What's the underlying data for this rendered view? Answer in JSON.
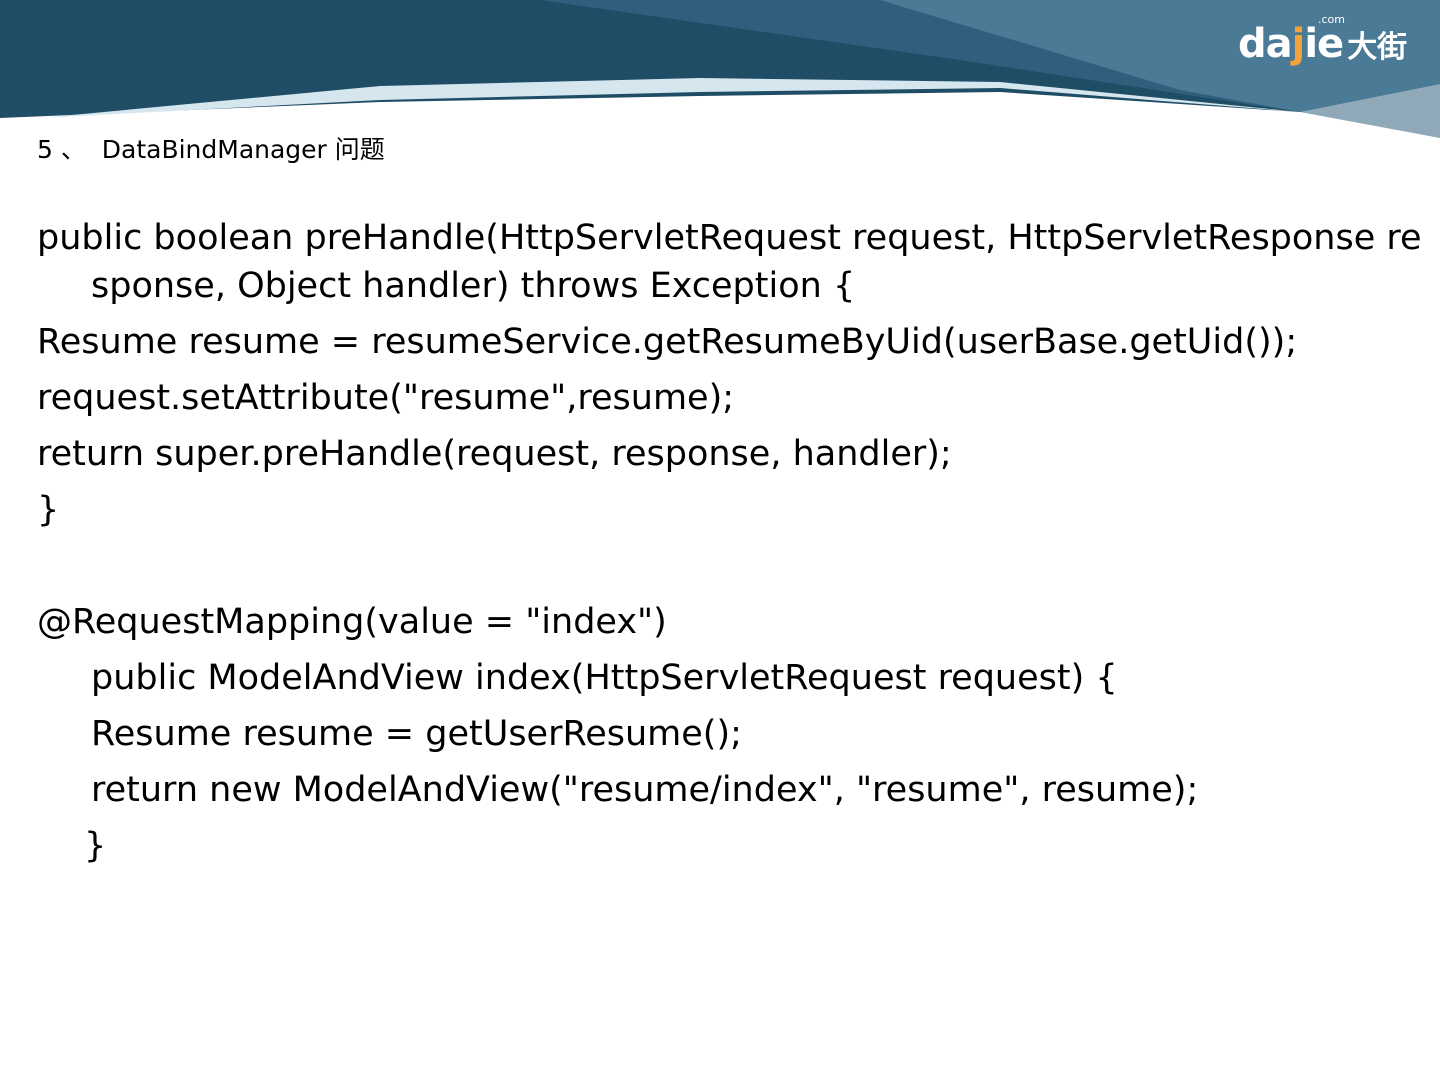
{
  "logo": {
    "latin_before": "da",
    "latin_j": "j",
    "latin_after": "ie",
    "chinese": "大街",
    "com": ".com"
  },
  "slide": {
    "section_title": "5 、  DataBindManager 问题",
    "code_lines": [
      "public boolean preHandle(HttpServletRequest request, HttpServletResponse re",
      "sponse, Object handler) throws Exception {",
      "Resume resume = resumeService.getResumeByUid(userBase.getUid());",
      "request.setAttribute(\"resume\",resume);",
      "return super.preHandle(request, response, handler);",
      "}",
      "@RequestMapping(value = \"index\")",
      "public ModelAndView index(HttpServletRequest request) {",
      "Resume resume = getUserResume();",
      "return new ModelAndView(\"resume/index\", \"resume\", resume);",
      "}"
    ]
  },
  "colors": {
    "banner_dark": "#1f4d66",
    "banner_mid": "#4a7a96",
    "banner_light": "#d6e6ef",
    "logo_accent": "#f2a33a"
  }
}
